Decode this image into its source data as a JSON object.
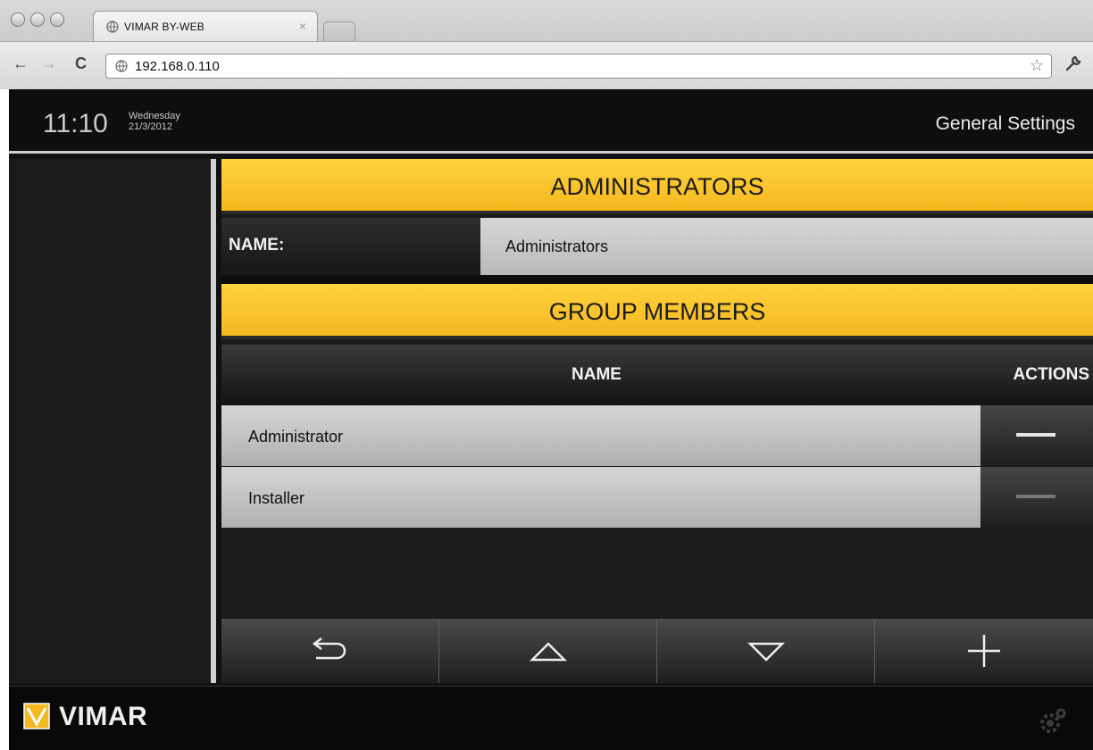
{
  "browser": {
    "tab_title": "VIMAR BY-WEB",
    "tab_close": "×",
    "url": "192.168.0.110"
  },
  "header": {
    "time": "11:10",
    "weekday": "Wednesday",
    "date": "21/3/2012",
    "title": "General Settings"
  },
  "group": {
    "section_title": "ADMINISTRATORS",
    "name_label": "NAME:",
    "name_value": "Administrators"
  },
  "members": {
    "section_title": "GROUP MEMBERS",
    "columns": {
      "name": "NAME",
      "actions": "ACTIONS"
    },
    "rows": [
      {
        "name": "Administrator",
        "remove_enabled": true
      },
      {
        "name": "Installer",
        "remove_enabled": false
      }
    ]
  },
  "toolbar": {
    "buttons": [
      "back-icon",
      "arrow-up-icon",
      "arrow-down-icon",
      "plus-icon"
    ]
  },
  "footer": {
    "brand": "VIMAR",
    "brand_color": "#f5b81e"
  },
  "colors": {
    "accent_yellow": "#ffd23e",
    "dark": "#111111",
    "row_light": "#c4c4c4"
  }
}
